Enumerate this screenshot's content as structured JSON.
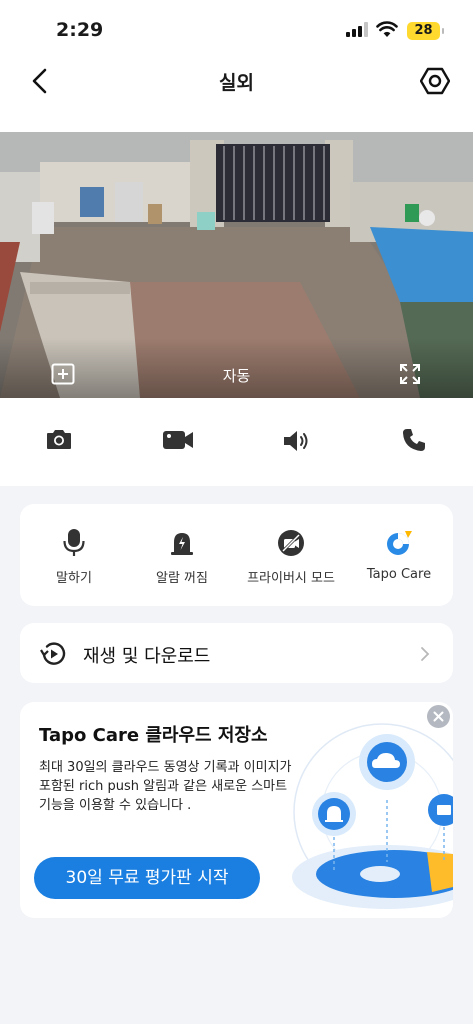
{
  "status_bar": {
    "time": "2:29",
    "battery": "28"
  },
  "header": {
    "title": "실외"
  },
  "camera": {
    "mode_label": "자동"
  },
  "controls": [
    {
      "name": "snapshot",
      "icon": "camera-icon"
    },
    {
      "name": "record",
      "icon": "video-camera-icon"
    },
    {
      "name": "audio",
      "icon": "speaker-icon"
    },
    {
      "name": "call",
      "icon": "phone-icon"
    }
  ],
  "features": [
    {
      "label": "말하기",
      "icon": "microphone-icon"
    },
    {
      "label": "알람 꺼짐",
      "icon": "alarm-off-icon"
    },
    {
      "label": "프라이버시 모드",
      "icon": "privacy-mode-icon"
    },
    {
      "label": "Tapo Care",
      "icon": "tapo-care-icon"
    }
  ],
  "playback": {
    "label": "재생 및 다운로드"
  },
  "promo": {
    "title": "Tapo Care 클라우드 저장소",
    "description": "최대 30일의 클라우드 동영상 기록과 이미지가 포함된 rich push 알림과 같은 새로운 스마트 기능을 이용할 수 있습니다 .",
    "button": "30일 무료 평가판 시작"
  },
  "colors": {
    "accent": "#1a7fe0",
    "battery": "#ffd92e",
    "background": "#f3f4f8"
  }
}
